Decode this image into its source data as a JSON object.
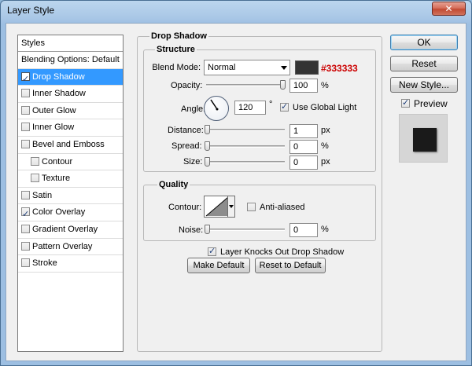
{
  "window": {
    "title": "Layer Style",
    "close_glyph": "✕"
  },
  "styles_list": {
    "header": "Styles",
    "blending_options": "Blending Options: Default",
    "items": [
      {
        "label": "Drop Shadow",
        "checked": true,
        "selected": true
      },
      {
        "label": "Inner Shadow",
        "checked": false
      },
      {
        "label": "Outer Glow",
        "checked": false
      },
      {
        "label": "Inner Glow",
        "checked": false
      },
      {
        "label": "Bevel and Emboss",
        "checked": false
      },
      {
        "label": "Contour",
        "checked": false
      },
      {
        "label": "Texture",
        "checked": false
      },
      {
        "label": "Satin",
        "checked": false
      },
      {
        "label": "Color Overlay",
        "checked": true
      },
      {
        "label": "Gradient Overlay",
        "checked": false
      },
      {
        "label": "Pattern Overlay",
        "checked": false
      },
      {
        "label": "Stroke",
        "checked": false
      }
    ]
  },
  "drop_shadow": {
    "title": "Drop Shadow",
    "structure": {
      "title": "Structure",
      "blend_mode_label": "Blend Mode:",
      "blend_mode_value": "Normal",
      "shadow_color": "#333333",
      "shadow_color_label": "#333333",
      "opacity_label": "Opacity:",
      "opacity_value": "100",
      "opacity_percent": 100,
      "opacity_unit": "%",
      "angle_label": "Angle:",
      "angle_value": "120",
      "angle_unit": "°",
      "use_global_light_label": "Use Global Light",
      "use_global_light_checked": true,
      "distance_label": "Distance:",
      "distance_value": "1",
      "distance_unit": "px",
      "spread_label": "Spread:",
      "spread_value": "0",
      "spread_unit": "%",
      "size_label": "Size:",
      "size_value": "0",
      "size_unit": "px"
    },
    "quality": {
      "title": "Quality",
      "contour_label": "Contour:",
      "anti_aliased_label": "Anti-aliased",
      "anti_aliased_checked": false,
      "noise_label": "Noise:",
      "noise_value": "0",
      "noise_unit": "%"
    },
    "layer_knocks_out_label": "Layer Knocks Out Drop Shadow",
    "layer_knocks_out_checked": true,
    "make_default_label": "Make Default",
    "reset_to_default_label": "Reset to Default"
  },
  "actions": {
    "ok_label": "OK",
    "reset_label": "Reset",
    "new_style_label": "New Style...",
    "preview_label": "Preview",
    "preview_checked": true
  },
  "colors": {
    "selection": "#3399ff",
    "accent_red": "#cc0000",
    "preview_square": "#1a1a1a"
  }
}
